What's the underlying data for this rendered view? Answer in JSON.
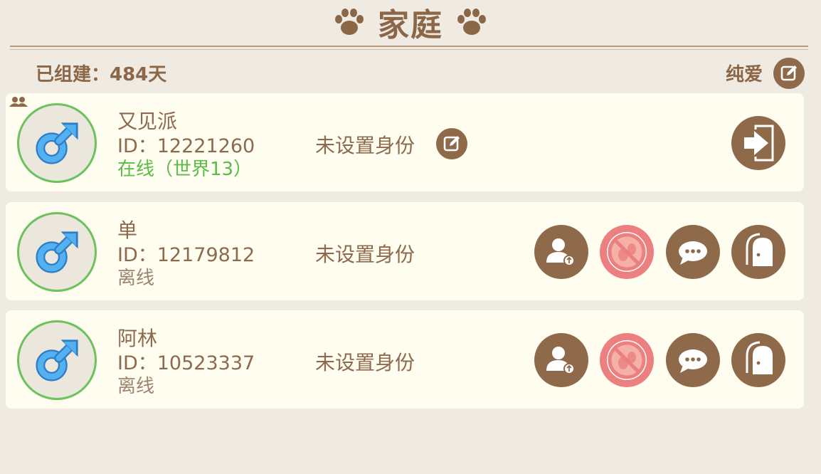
{
  "header": {
    "title": "家庭"
  },
  "family": {
    "age_label": "已组建：484天",
    "type_label": "纯爱"
  },
  "members": [
    {
      "name": "又见派",
      "id_label": "ID：12221260",
      "status": "在线（世界13）",
      "online": true,
      "role": "未设置身份"
    },
    {
      "name": "单",
      "id_label": "ID：12179812",
      "status": "离线",
      "online": false,
      "role": "未设置身份"
    },
    {
      "name": "阿林",
      "id_label": "ID：10523337",
      "status": "离线",
      "online": false,
      "role": "未设置身份"
    }
  ],
  "icons": {
    "header": "paw-icon",
    "group": "group-icon",
    "avatar": "male-icon",
    "edit": "edit-icon",
    "leave": "exit-icon",
    "promote": "promote-member-icon",
    "ban": "no-entry-icon",
    "chat": "chat-icon",
    "kick": "door-icon"
  },
  "colors": {
    "background": "#efebe3",
    "card": "#fefdf0",
    "brown": "#8f6a4a",
    "text": "#8d6a4d",
    "online": "#5cbb47",
    "avatar_ring": "#6cc25c",
    "ban": "#ec7f80",
    "male": "#4aa8ea"
  }
}
